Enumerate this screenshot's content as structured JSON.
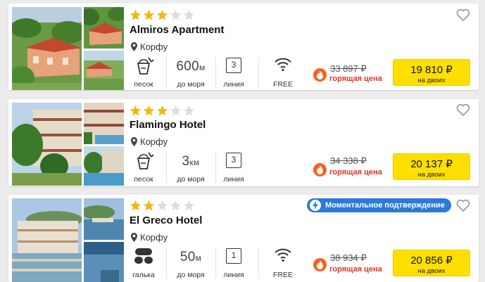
{
  "colors": {
    "star_on": "#f5b512",
    "star_off": "#dddddd",
    "hot": "#e3322b",
    "price_button": "#ffdf00",
    "badge": "#2c7ad6"
  },
  "hotels": [
    {
      "name": "Almiros Apartment",
      "stars": 3,
      "location": "Корфу",
      "beach": {
        "value": "песок",
        "icon": "sand-bucket-icon"
      },
      "distance": {
        "value": "600",
        "unit": "м",
        "label": "до моря"
      },
      "line": {
        "value": "3",
        "label": "линия"
      },
      "wifi": {
        "label": "FREE",
        "icon": "wifi-icon"
      },
      "old_price": "33 897 ₽",
      "hot_label": "горящая цена",
      "price": "19 810 ₽",
      "price_label": "на двоих"
    },
    {
      "name": "Flamingo Hotel",
      "stars": 3,
      "location": "Корфу",
      "beach": {
        "value": "песок",
        "icon": "sand-bucket-icon"
      },
      "distance": {
        "value": "3",
        "unit": "км",
        "label": "до моря"
      },
      "line": {
        "value": "3",
        "label": "линия"
      },
      "old_price": "34 338 ₽",
      "hot_label": "горящая цена",
      "price": "20 137 ₽",
      "price_label": "на двоих"
    },
    {
      "name": "El Greco Hotel",
      "stars": 2,
      "location": "Корфу",
      "badge": "Моментальное подтверждение",
      "beach": {
        "value": "галька",
        "icon": "pebbles-icon"
      },
      "distance": {
        "value": "50",
        "unit": "м",
        "label": "до моря"
      },
      "line": {
        "value": "1",
        "label": "линия"
      },
      "wifi": {
        "label": "FREE",
        "icon": "wifi-icon"
      },
      "old_price": "38 934 ₽",
      "hot_label": "горящая цена",
      "price": "20 856 ₽",
      "price_label": "на двоих"
    }
  ]
}
